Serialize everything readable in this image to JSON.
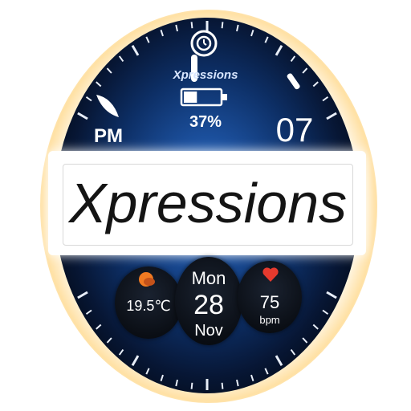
{
  "watchface": {
    "brand_small": "Xpressions",
    "battery_percent": "37%",
    "am_pm": "PM",
    "minute": "07",
    "banner_text": "Xpressions",
    "weather": {
      "temperature": "19.5℃"
    },
    "date": {
      "weekday": "Mon",
      "day": "28",
      "month": "Nov"
    },
    "heart_rate": {
      "value": "75",
      "unit": "bpm"
    },
    "battery_level": 0.37
  },
  "icons": {
    "watch": "watch-icon",
    "battery": "battery-icon",
    "weather": "sun-cloud-icon",
    "heart": "heart-icon"
  },
  "colors": {
    "face_center": "#2a6fc9",
    "face_edge": "#000000",
    "heart": "#e63a2e",
    "weather_icon": "#f07a22",
    "battery_fill": "#ffffff"
  }
}
